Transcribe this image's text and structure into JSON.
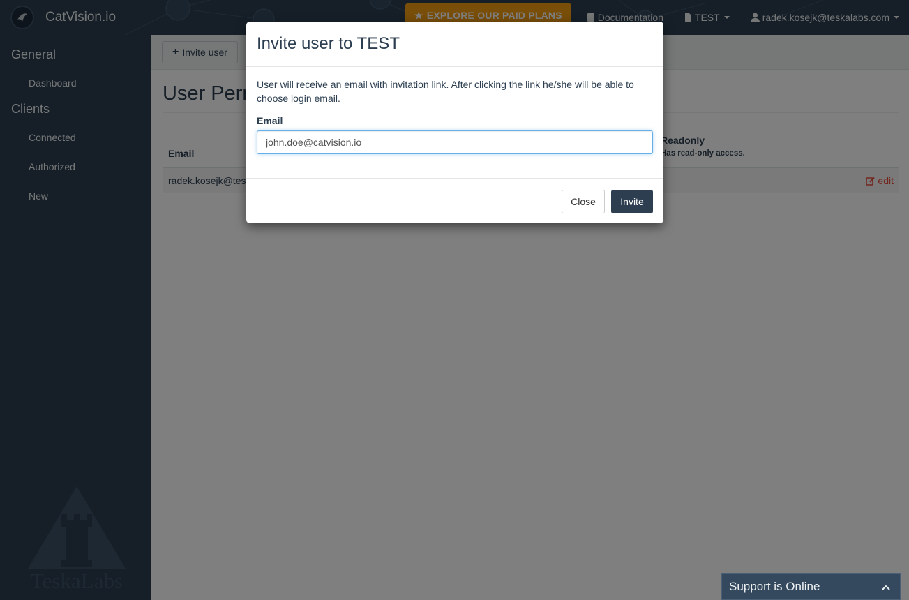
{
  "navbar": {
    "brand": "CatVision.io",
    "explore_label": "EXPLORE OUR PAID PLANS",
    "docs_label": "Documentation",
    "project_label": "TEST",
    "user_label": "radek.kosejk@teskalabs.com"
  },
  "sidebar": {
    "sections": [
      {
        "title": "General",
        "items": [
          "Dashboard"
        ]
      },
      {
        "title": "Clients",
        "items": [
          "Connected",
          "Authorized",
          "New"
        ]
      }
    ],
    "watermark": "TeskaLabs"
  },
  "main": {
    "invite_button": "Invite user",
    "page_title": "User Permissions",
    "table": {
      "col_email": "Email",
      "col_readonly": "Readonly",
      "col_readonly_sub": "Has read-only access.",
      "rows": [
        {
          "email": "radek.kosejk@teskalabs.com",
          "action": "edit"
        }
      ]
    }
  },
  "modal": {
    "title": "Invite user to TEST",
    "description": "User will receive an email with invitation link. After clicking the link he/she will be able to choose login email.",
    "email_label": "Email",
    "email_value": "john.doe@catvision.io",
    "close_label": "Close",
    "invite_label": "Invite"
  },
  "support": {
    "label": "Support is Online"
  },
  "colors": {
    "navbar": "#2c3e50",
    "accent": "#f39c12",
    "danger": "#e74c3c"
  }
}
